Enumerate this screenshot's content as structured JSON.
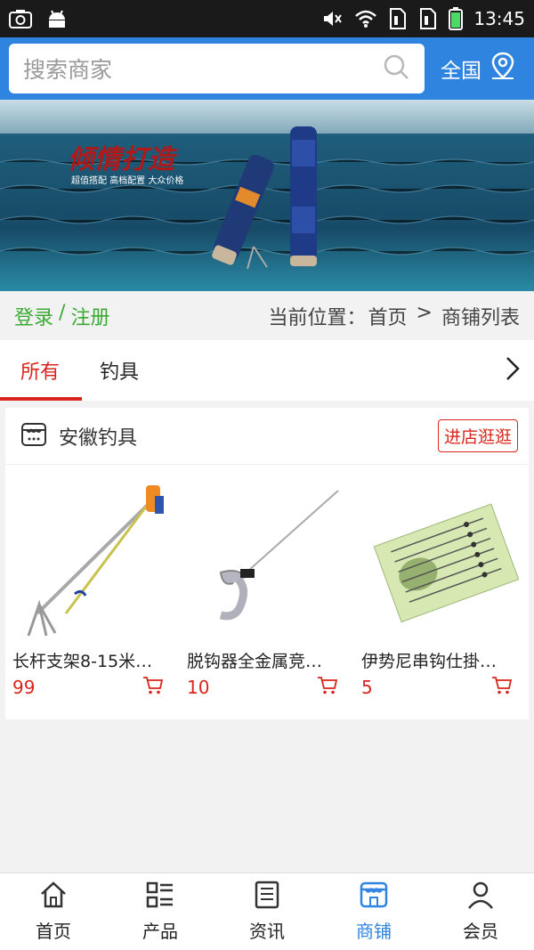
{
  "status": {
    "time": "13:45"
  },
  "search": {
    "placeholder": "搜索商家",
    "region": "全国"
  },
  "banner": {
    "headline": "倾情打造",
    "tagline": "超值搭配 高档配置 大众价格"
  },
  "crumb": {
    "login": "登录",
    "sep": "/",
    "register": "注册",
    "location_label": "当前位置：",
    "home": "首页",
    "arrow": ">",
    "current": "商铺列表"
  },
  "tabs": [
    {
      "label": "所有"
    },
    {
      "label": "钓具"
    }
  ],
  "shop": {
    "name": "安徽钓具",
    "visit_label": "进店逛逛",
    "products": [
      {
        "title": "长杆支架8-15米…",
        "price": "99"
      },
      {
        "title": "脱钩器全金属竞…",
        "price": "10"
      },
      {
        "title": "伊势尼串钩仕掛…",
        "price": "5"
      }
    ]
  },
  "nav": [
    {
      "label": "首页",
      "icon": "home-icon"
    },
    {
      "label": "产品",
      "icon": "grid-list-icon"
    },
    {
      "label": "资讯",
      "icon": "news-icon"
    },
    {
      "label": "商铺",
      "icon": "store-icon",
      "active": true
    },
    {
      "label": "会员",
      "icon": "user-icon"
    }
  ],
  "colors": {
    "brand_blue": "#2f84e0",
    "accent_red": "#d9261c",
    "login_green": "#3aaa35"
  }
}
